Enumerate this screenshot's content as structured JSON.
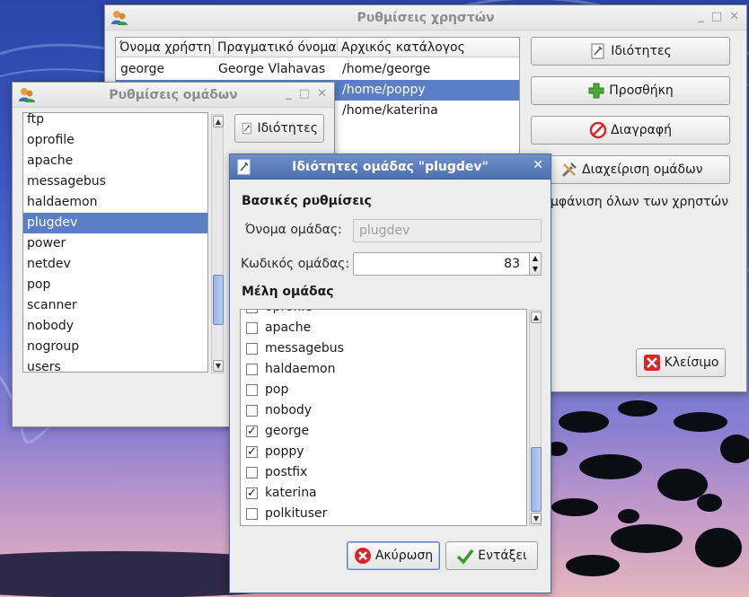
{
  "users_window": {
    "title": "Ρυθμίσεις χρηστών",
    "columns": [
      "Όνομα χρήστη",
      "Πραγματικό όνομα",
      "Αρχικός κατάλογος"
    ],
    "rows": [
      {
        "user": "george",
        "real": "George Vlahavas",
        "home": "/home/george"
      },
      {
        "user": "",
        "real": "",
        "home": "/home/poppy"
      },
      {
        "user": "",
        "real": "",
        "home": "/home/katerina"
      }
    ],
    "buttons": {
      "properties": "Ιδιότητες",
      "add": "Προσθήκη",
      "delete": "Διαγραφή",
      "manage_groups": "Διαχείριση ομάδων",
      "close": "Κλείσιμο"
    },
    "show_all_partial": "μφάνιση όλων των χρηστών"
  },
  "groups_window": {
    "title": "Ρυθμίσεις ομάδων",
    "groups": [
      "ftp",
      "oprofile",
      "apache",
      "messagebus",
      "haldaemon",
      "plugdev",
      "power",
      "netdev",
      "pop",
      "scanner",
      "nobody",
      "nogroup",
      "users"
    ],
    "selected_index": 5,
    "properties_button": "Ιδιότητες"
  },
  "group_dialog": {
    "title": "Ιδιότητες ομάδας \"plugdev\"",
    "basic_settings": "Βασικές ρυθμίσεις",
    "group_name_label": "Όνομα ομάδας:",
    "group_name_value": "plugdev",
    "group_id_label": "Κωδικός ομάδας:",
    "group_id_value": "83",
    "members_label": "Μέλη ομάδας",
    "members": [
      {
        "name": "oprofile",
        "checked": false
      },
      {
        "name": "apache",
        "checked": false
      },
      {
        "name": "messagebus",
        "checked": false
      },
      {
        "name": "haldaemon",
        "checked": false
      },
      {
        "name": "pop",
        "checked": false
      },
      {
        "name": "nobody",
        "checked": false
      },
      {
        "name": "george",
        "checked": true
      },
      {
        "name": "poppy",
        "checked": true
      },
      {
        "name": "postfix",
        "checked": false
      },
      {
        "name": "katerina",
        "checked": true
      },
      {
        "name": "polkituser",
        "checked": false
      }
    ],
    "cancel_button": "Ακύρωση",
    "ok_button": "Εντάξει"
  },
  "colors": {
    "selection": "#5a7fc6",
    "active_title": "#4e70b0",
    "add_icon": "#4fa93a",
    "delete_icon": "#d8262a",
    "ok_icon": "#3a9a2a"
  },
  "icons": [
    "users-app-icon",
    "properties-icon",
    "add-icon",
    "delete-icon",
    "manage-groups-icon",
    "close-icon",
    "cancel-icon",
    "ok-icon"
  ]
}
